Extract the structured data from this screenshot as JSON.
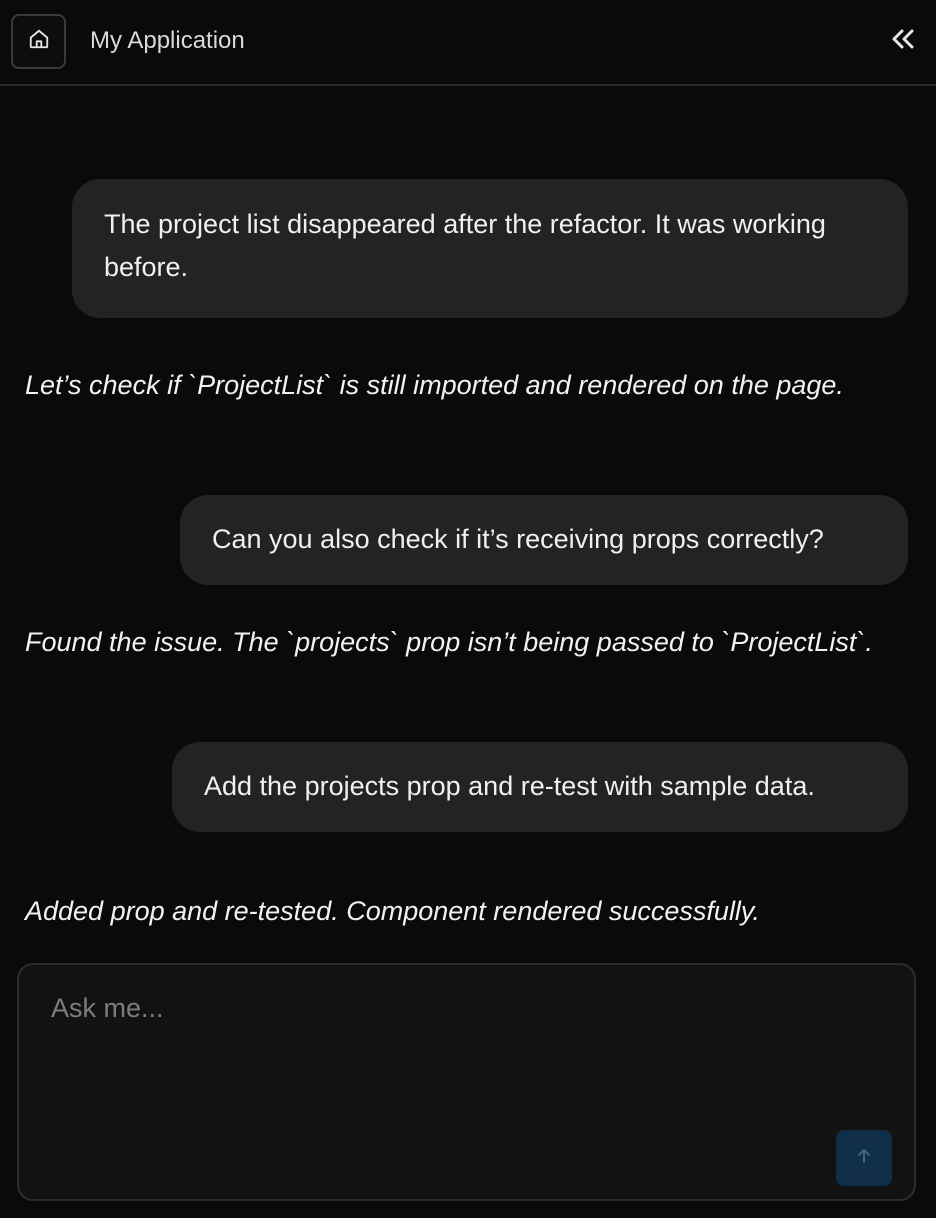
{
  "header": {
    "title": "My Application",
    "home_icon": "home-icon",
    "collapse_icon": "chevrons-left-icon"
  },
  "messages": [
    {
      "role": "user",
      "text": "The project list disappeared after the refactor. It was working before."
    },
    {
      "role": "assistant",
      "text": "Let’s check if `ProjectList` is still imported and rendered on the page."
    },
    {
      "role": "user",
      "text": "Can you also check if it’s receiving props correctly?"
    },
    {
      "role": "assistant",
      "text": "Found the issue. The `projects` prop isn’t being passed to `ProjectList`."
    },
    {
      "role": "user",
      "text": "Add the projects prop and re-test with sample data."
    },
    {
      "role": "assistant",
      "text": "Added prop and re-tested. Component rendered successfully."
    }
  ],
  "composer": {
    "placeholder": "Ask me...",
    "value": "",
    "send_icon": "arrow-up-icon"
  },
  "colors": {
    "background": "#0a0a0a",
    "user_bubble": "#232323",
    "composer_bg": "#121212",
    "send_button": "#102d4a"
  }
}
